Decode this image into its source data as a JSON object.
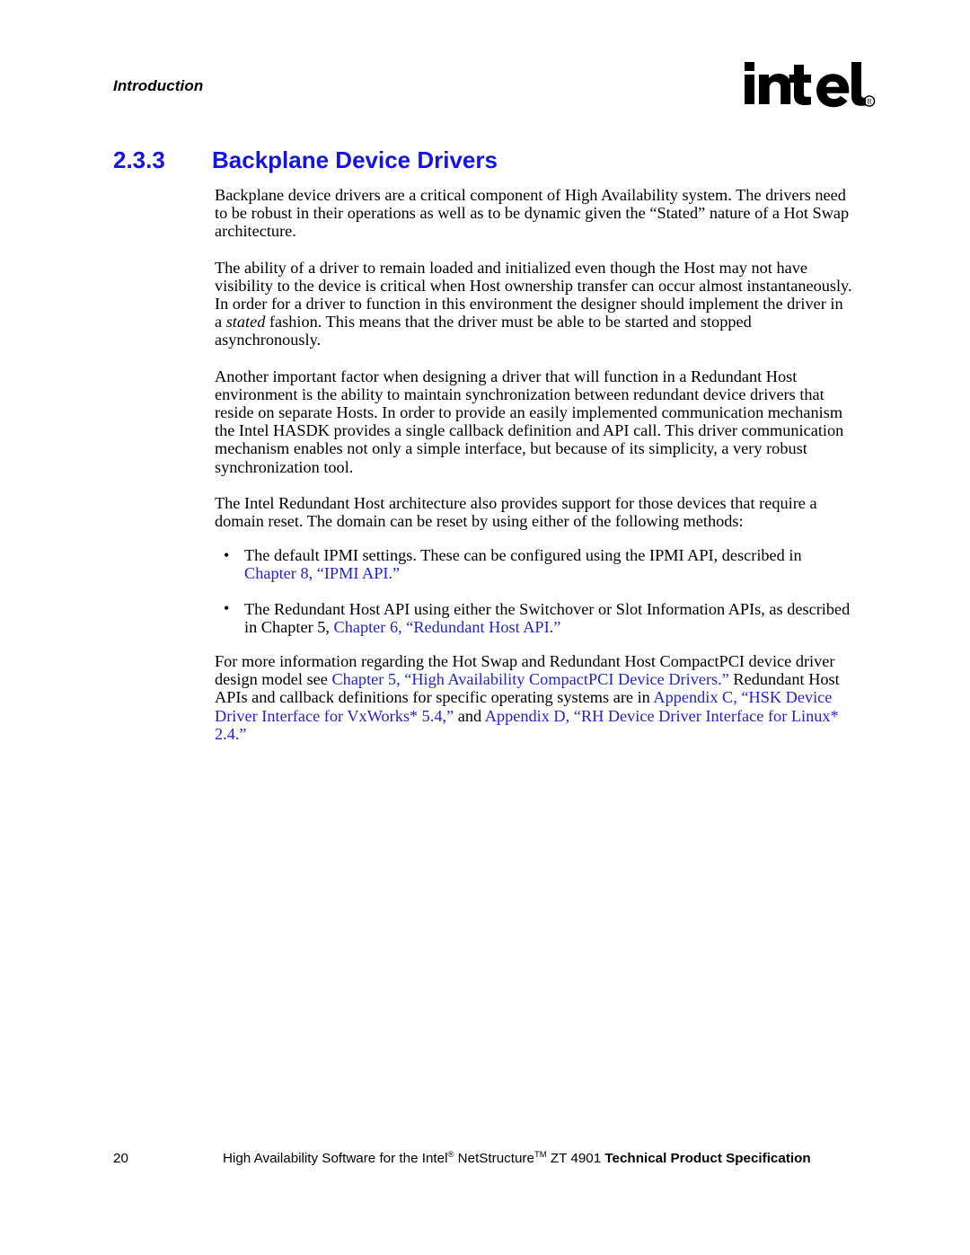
{
  "header": {
    "running_head": "Introduction",
    "logo_word": "intel",
    "logo_mark": "®"
  },
  "heading": {
    "number": "2.3.3",
    "title": "Backplane Device Drivers"
  },
  "body": {
    "paragraph_1": "Backplane device drivers are a critical component of High Availability system. The drivers need to be robust in their operations as well as to be dynamic given the “Stated” nature of a Hot Swap architecture.",
    "paragraph_2_a": "The ability of a driver to remain loaded and initialized even though the Host may not have visibility to the device is critical when Host ownership transfer can occur almost instantaneously. In order for a driver to function in this environment the designer should implement the driver in a ",
    "paragraph_2_italic": "stated",
    "paragraph_2_b": " fashion. This means that the driver must be able to be started and stopped asynchronously.",
    "paragraph_3": "Another important factor when designing a driver that will function in a Redundant Host environment is the ability to maintain synchronization between redundant device drivers that reside on separate Hosts. In order to provide an easily implemented communication mechanism the Intel HASDK provides a single callback definition and API call. This driver communication mechanism enables not only a simple interface, but because of its simplicity, a very robust synchronization tool.",
    "paragraph_4": "The Intel Redundant Host architecture also provides support for those devices that require a domain reset. The domain can be reset by using either of the following methods:",
    "bullets": [
      {
        "marker": "•",
        "text_before": "The default IPMI settings. These can be configured using the IPMI API, described in ",
        "link": "Chapter 8, “IPMI API.”",
        "text_after": ""
      },
      {
        "marker": "•",
        "text_before": "The Redundant Host API using either the Switchover or Slot Information APIs, as described in Chapter 5, ",
        "link": "Chapter 6, “Redundant Host API.”",
        "text_after": ""
      }
    ],
    "paragraph_5_a": "For more information regarding the Hot Swap and Redundant Host CompactPCI device driver design model see ",
    "paragraph_5_link1": "Chapter 5, “High Availability CompactPCI Device Drivers.”",
    "paragraph_5_b": " Redundant Host APIs and callback definitions for specific operating systems are in ",
    "paragraph_5_link2": "Appendix C, “HSK Device Driver Interface for VxWorks* 5.4,”",
    "paragraph_5_c": " and ",
    "paragraph_5_link3": "Appendix D, “RH Device Driver Interface for Linux* 2.4.”"
  },
  "footer": {
    "page_number": "20",
    "text_1": "High Availability Software for the Intel",
    "sup_1": "®",
    "text_2": " NetStructure",
    "sup_2": "TM",
    "text_3": " ZT 4901 ",
    "bold_text": "Technical Product Specification"
  },
  "colors": {
    "heading_blue": "#1414e6",
    "link_blue": "#2323cc",
    "text_black": "#000000",
    "page_background": "#ffffff"
  }
}
